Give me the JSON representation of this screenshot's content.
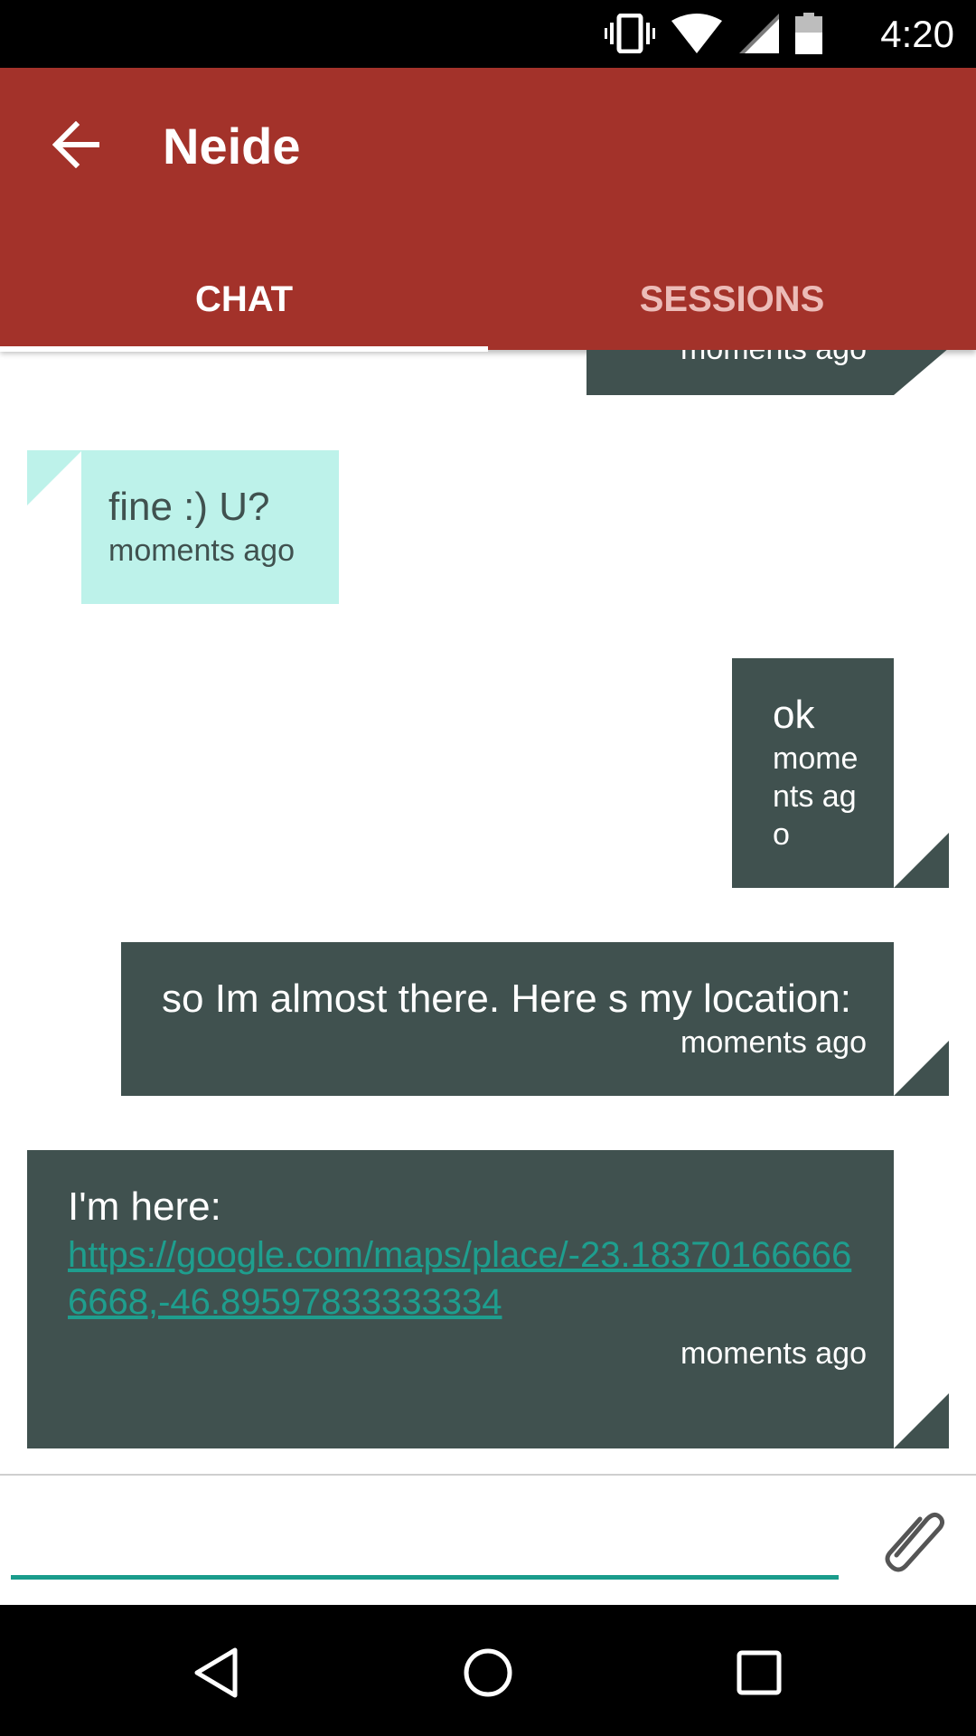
{
  "status_bar": {
    "time": "4:20",
    "icons": [
      "vibrate-icon",
      "wifi-icon",
      "cell-signal-icon",
      "battery-icon"
    ]
  },
  "app_bar": {
    "title": "Neide",
    "tabs": [
      {
        "label": "CHAT",
        "active": true
      },
      {
        "label": "SESSIONS",
        "active": false
      }
    ],
    "color": "#a3322a"
  },
  "messages": [
    {
      "direction": "outgoing",
      "text": "",
      "time": "moments ago"
    },
    {
      "direction": "incoming",
      "text": "fine :) U?",
      "time": "moments ago"
    },
    {
      "direction": "outgoing",
      "text": "ok",
      "time": "moments ago"
    },
    {
      "direction": "outgoing",
      "text": "so Im almost there. Here s my location:",
      "time": "moments ago"
    },
    {
      "direction": "outgoing",
      "text": "I'm here:",
      "link": "https://google.com/maps/place/-23.183701666666668,-46.89597833333334",
      "time": "moments ago"
    }
  ],
  "composer": {
    "placeholder": "",
    "value": ""
  },
  "colors": {
    "outgoing_bubble": "#40514f",
    "incoming_bubble": "#bdf2ea",
    "accent": "#1a9c8c"
  }
}
